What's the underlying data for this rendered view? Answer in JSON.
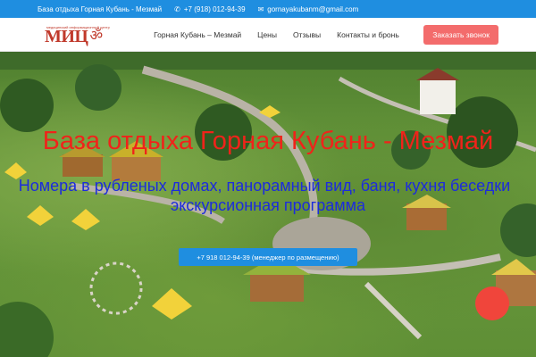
{
  "topbar": {
    "site_title": "База отдыха Горная Кубань - Мезмай",
    "phone": "+7 (918) 012-94-39",
    "email": "gornayakubanm@gmail.com",
    "phone_icon": "phone-icon",
    "email_icon": "envelope-icon"
  },
  "logo": {
    "text": "МИЦ",
    "symbol": "ॐ",
    "small_text": "медицинский информационный центр"
  },
  "nav": {
    "items": [
      {
        "label": "Горная Кубань – Мезмай"
      },
      {
        "label": "Цены"
      },
      {
        "label": "Отзывы"
      },
      {
        "label": "Контакты и бронь"
      }
    ],
    "cta_label": "Заказать звонок"
  },
  "hero": {
    "title": "База отдыха Горная Кубань - Мезмай",
    "subtitle_line1": "Номера в рубленых домах, панорамный вид, баня, кухня беседки",
    "subtitle_line2": "экскурсионная программа",
    "phone_button": "+7 918 012-94-39 (менеджер по размещению)"
  },
  "colors": {
    "topbar": "#1f8ee0",
    "cta": "#f36c6c",
    "title": "#f0231a",
    "subtitle": "#1c2cdc",
    "bubble": "#f0453b"
  }
}
